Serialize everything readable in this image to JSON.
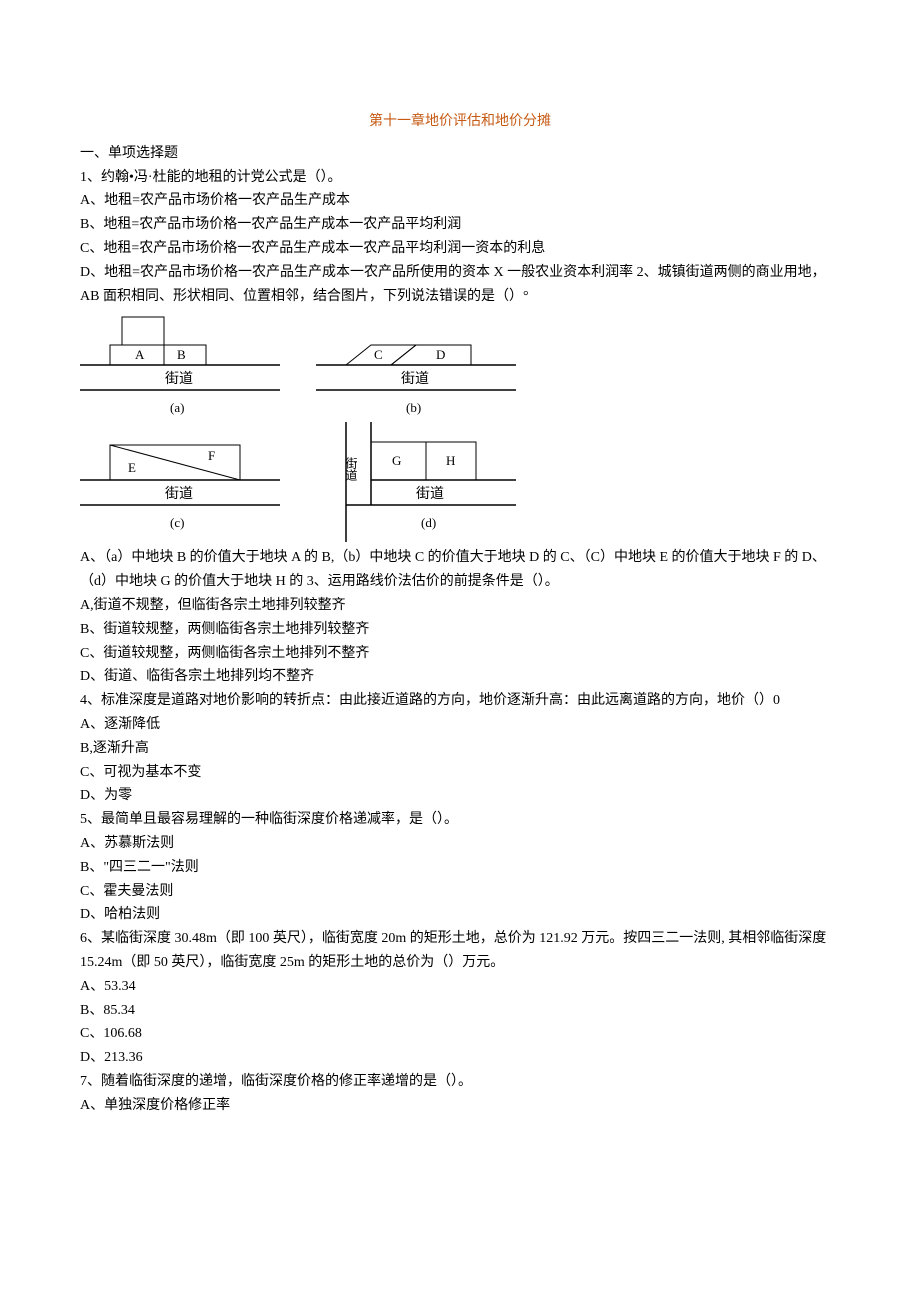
{
  "title": "第十一章地价评估和地价分摊",
  "section1": "一、单项选择题",
  "q1": "1、约翰•冯·杜能的地租的计党公式是（）。",
  "q1A": "A、地租=农产品市场价格一农产品生产成本",
  "q1B": "B、地租=农产品市场价格一农产品生产成本一农产品平均利润",
  "q1C": "C、地租=农产品市场价格一农产品生产成本一农产品平均利润一资本的利息",
  "q1D": "D、地租=农产品市场价格一农产品生产成本一农产品所使用的资本 X 一般农业资本利润率 2、城镇街道两侧的商业用地，AB 面积相同、形状相同、位置相邻，结合图片，下列说法错误的是（）°",
  "diagA_lblA": "A",
  "diagA_lblB": "B",
  "diagA_street": "街道",
  "diagA_cap": "(a)",
  "diagB_lblC": "C",
  "diagB_lblD": "D",
  "diagB_street": "街道",
  "diagB_cap": "(b)",
  "diagC_lblE": "E",
  "diagC_lblF": "F",
  "diagC_street": "街道",
  "diagC_cap": "(c)",
  "diagD_side": "街道",
  "diagD_lblG": "G",
  "diagD_lblH": "H",
  "diagD_street": "街道",
  "diagD_cap": "(d)",
  "q2A": "A、（a）中地块 B 的价值大于地块 A 的 B,（b）中地块 C 的价值大于地块 D 的 C、（C）中地块 E 的价值大于地块 F 的 D、（d）中地块 G 的价值大于地块 H 的 3、运用路线价法估价的前提条件是（）。",
  "q3A": "A,街道不规整，但临街各宗土地排列较整齐",
  "q3B": "B、街道较规整，两侧临街各宗土地排列较整齐",
  "q3C": "C、街道较规整，两侧临街各宗土地排列不整齐",
  "q3D": "D、街道、临街各宗土地排列均不整齐",
  "q4": "4、标准深度是道路对地价影响的转折点：由此接近道路的方向，地价逐渐升高：由此远离道路的方向，地价（）0",
  "q4A": "A、逐渐降低",
  "q4B": "B,逐渐升高",
  "q4C": "C、可视为基本不变",
  "q4D": "D、为零",
  "q5": "5、最简单且最容易理解的一种临街深度价格递减率，是（）。",
  "q5A": "A、苏慕斯法则",
  "q5B": "B、\"四三二一\"法则",
  "q5C": "C、霍夫曼法则",
  "q5D": "D、哈柏法则",
  "q6": "6、某临街深度 30.48m（即 100 英尺），临街宽度 20m 的矩形土地，总价为 121.92 万元。按四三二一法则, 其相邻临街深度 15.24m（即 50 英尺），临街宽度 25m 的矩形土地的总价为（）万元。",
  "q6A": "A、53.34",
  "q6B": "B、85.34",
  "q6C": "C、106.68",
  "q6D": "D、213.36",
  "q7": "7、随着临街深度的递增，临街深度价格的修正率递增的是（）。",
  "q7A": "A、单独深度价格修正率"
}
